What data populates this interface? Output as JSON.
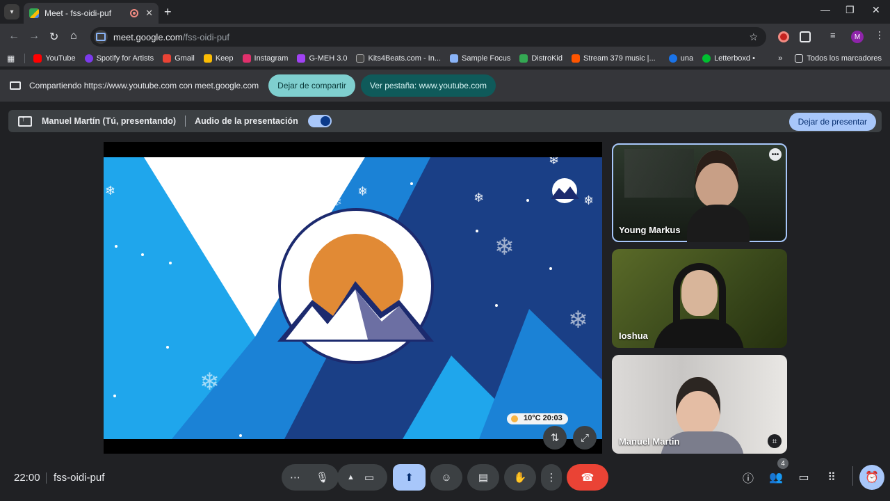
{
  "browser": {
    "tab_title": "Meet - fss-oidi-puf",
    "url_host": "meet.google.com",
    "url_path": "/fss-oidi-puf",
    "profile_initial": "M"
  },
  "bookmarks": [
    {
      "label": "YouTube",
      "color": "#ff0000"
    },
    {
      "label": "Spotify for Artists",
      "color": "#7c3aed"
    },
    {
      "label": "Gmail",
      "color": "#ea4335"
    },
    {
      "label": "Keep",
      "color": "#fbbc04"
    },
    {
      "label": "Instagram",
      "color": "#e1306c"
    },
    {
      "label": "G-MEH 3.0",
      "color": "#a142f4"
    },
    {
      "label": "Kits4Beats.com - In...",
      "color": "#444444"
    },
    {
      "label": "Sample Focus",
      "color": "#8ab4f8"
    },
    {
      "label": "DistroKid",
      "color": "#34a853"
    },
    {
      "label": "Stream 379 music |...",
      "color": "#ff5500"
    },
    {
      "label": "una",
      "color": "#1a73e8"
    },
    {
      "label": "Letterboxd •",
      "color": "#00c030"
    }
  ],
  "bookmarks_all": "Todos los marcadores",
  "sharebar": {
    "text": "Compartiendo https://www.youtube.com con meet.google.com",
    "stop_label": "Dejar de compartir",
    "view_label": "Ver pestaña: www.youtube.com"
  },
  "present_bar": {
    "presenter": "Manuel Martín (Tú, presentando)",
    "audio_label": "Audio de la presentación",
    "audio_on": true,
    "stop_label": "Dejar de presentar"
  },
  "stage": {
    "weather_text": "10°C  20:03"
  },
  "participants": [
    {
      "name": "Young Markus",
      "active": true
    },
    {
      "name": "Ioshua",
      "active": false
    },
    {
      "name": "Manuel Martin",
      "active": false
    }
  ],
  "meeting": {
    "time": "22:00",
    "code": "fss-oidi-puf",
    "participant_count": "4"
  },
  "colors": {
    "accent": "#a8c7fa",
    "hangup": "#ea4335",
    "share_stop": "#7fcfcf",
    "share_view": "#0f5a5a"
  }
}
